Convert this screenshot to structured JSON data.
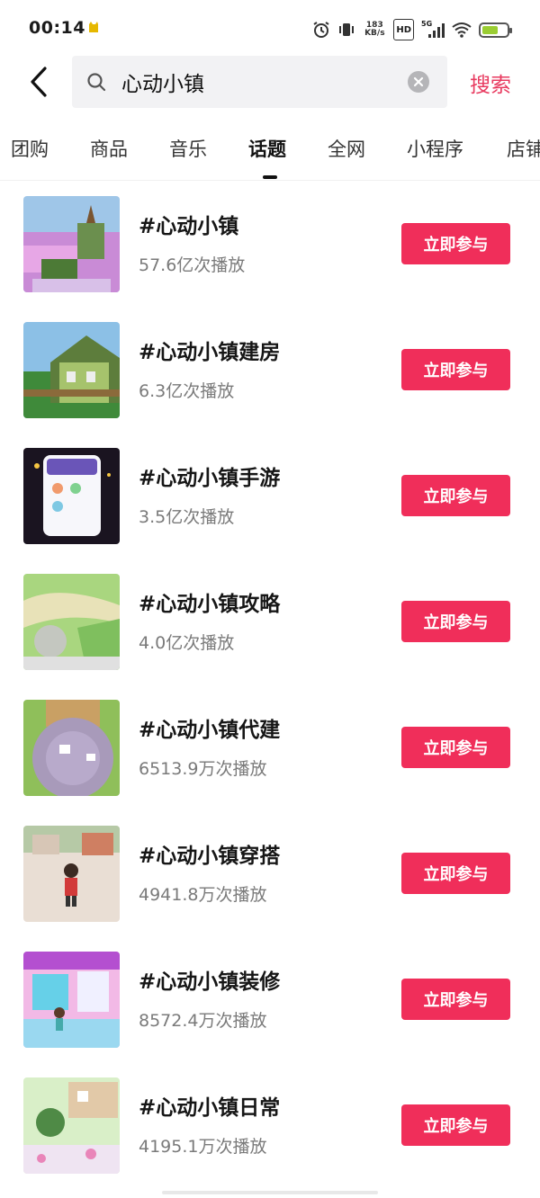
{
  "status_bar": {
    "time": "00:14",
    "net_speed_value": "183",
    "net_speed_unit": "KB/s",
    "hd_label": "HD",
    "network_label": "5G",
    "battery_level": 0.65,
    "icons": [
      "alarm-icon",
      "vibrate-icon",
      "signal-icon",
      "wifi-icon",
      "battery-icon"
    ]
  },
  "search": {
    "query": "心动小镇",
    "submit_label": "搜索",
    "icons": [
      "back-arrow-icon",
      "search-icon",
      "clear-icon"
    ]
  },
  "tabs": [
    {
      "label": "团购"
    },
    {
      "label": "商品"
    },
    {
      "label": "音乐"
    },
    {
      "label": "话题"
    },
    {
      "label": "全网"
    },
    {
      "label": "小程序"
    },
    {
      "label": "店铺"
    }
  ],
  "active_tab": "话题",
  "topics": [
    {
      "title": "#心动小镇",
      "plays": "57.6亿次播放",
      "action": "立即参与"
    },
    {
      "title": "#心动小镇建房",
      "plays": "6.3亿次播放",
      "action": "立即参与"
    },
    {
      "title": "#心动小镇手游",
      "plays": "3.5亿次播放",
      "action": "立即参与"
    },
    {
      "title": "#心动小镇攻略",
      "plays": "4.0亿次播放",
      "action": "立即参与"
    },
    {
      "title": "#心动小镇代建",
      "plays": "6513.9万次播放",
      "action": "立即参与"
    },
    {
      "title": "#心动小镇穿搭",
      "plays": "4941.8万次播放",
      "action": "立即参与"
    },
    {
      "title": "#心动小镇装修",
      "plays": "8572.4万次播放",
      "action": "立即参与"
    },
    {
      "title": "#心动小镇日常",
      "plays": "4195.1万次播放",
      "action": "立即参与"
    }
  ],
  "colors": {
    "accent": "#f02e5a",
    "search_text": "#e83a5f",
    "secondary_text": "#7a7a7a"
  }
}
